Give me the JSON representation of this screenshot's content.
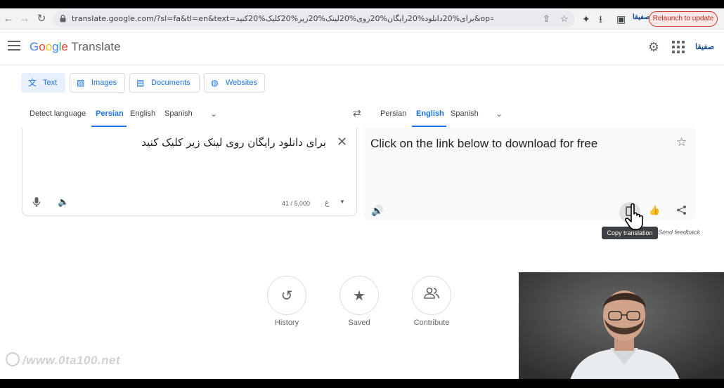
{
  "browser": {
    "url": "translate.google.com/?sl=fa&tl=en&text=برای%20دانلود%20رایگان%20روی%20لینک%20زیر%20کلیک%20کنید&op=translate",
    "profile_label": "صفیقا",
    "relaunch_label": "Relaunch to update"
  },
  "header": {
    "logo_google": [
      "G",
      "o",
      "o",
      "g",
      "l",
      "e"
    ],
    "logo_translate": "Translate",
    "account_label": "صفیقا"
  },
  "modes": [
    {
      "label": "Text",
      "icon": "translate-icon",
      "active": true
    },
    {
      "label": "Images",
      "icon": "image-icon",
      "active": false
    },
    {
      "label": "Documents",
      "icon": "document-icon",
      "active": false
    },
    {
      "label": "Websites",
      "icon": "globe-icon",
      "active": false
    }
  ],
  "source": {
    "languages": [
      "Detect language",
      "Persian",
      "English",
      "Spanish"
    ],
    "selected": "Persian",
    "text": "برای دانلود رایگان روی لینک زیر کلیک کنید",
    "char_count": "41 / 5,000"
  },
  "target": {
    "languages": [
      "Persian",
      "English",
      "Spanish"
    ],
    "selected": "English",
    "text": "Click on the link below to download for free",
    "tooltip": "Copy translation",
    "feedback": "Send feedback"
  },
  "bottom": [
    {
      "label": "History",
      "icon": "history-icon"
    },
    {
      "label": "Saved",
      "icon": "star-icon"
    },
    {
      "label": "Contribute",
      "icon": "people-icon"
    }
  ],
  "watermark": "/www.0ta100.net",
  "colors": {
    "accent": "#1a73e8",
    "tab_active_bg": "#e8f0fe",
    "relaunch": "#d93025"
  }
}
